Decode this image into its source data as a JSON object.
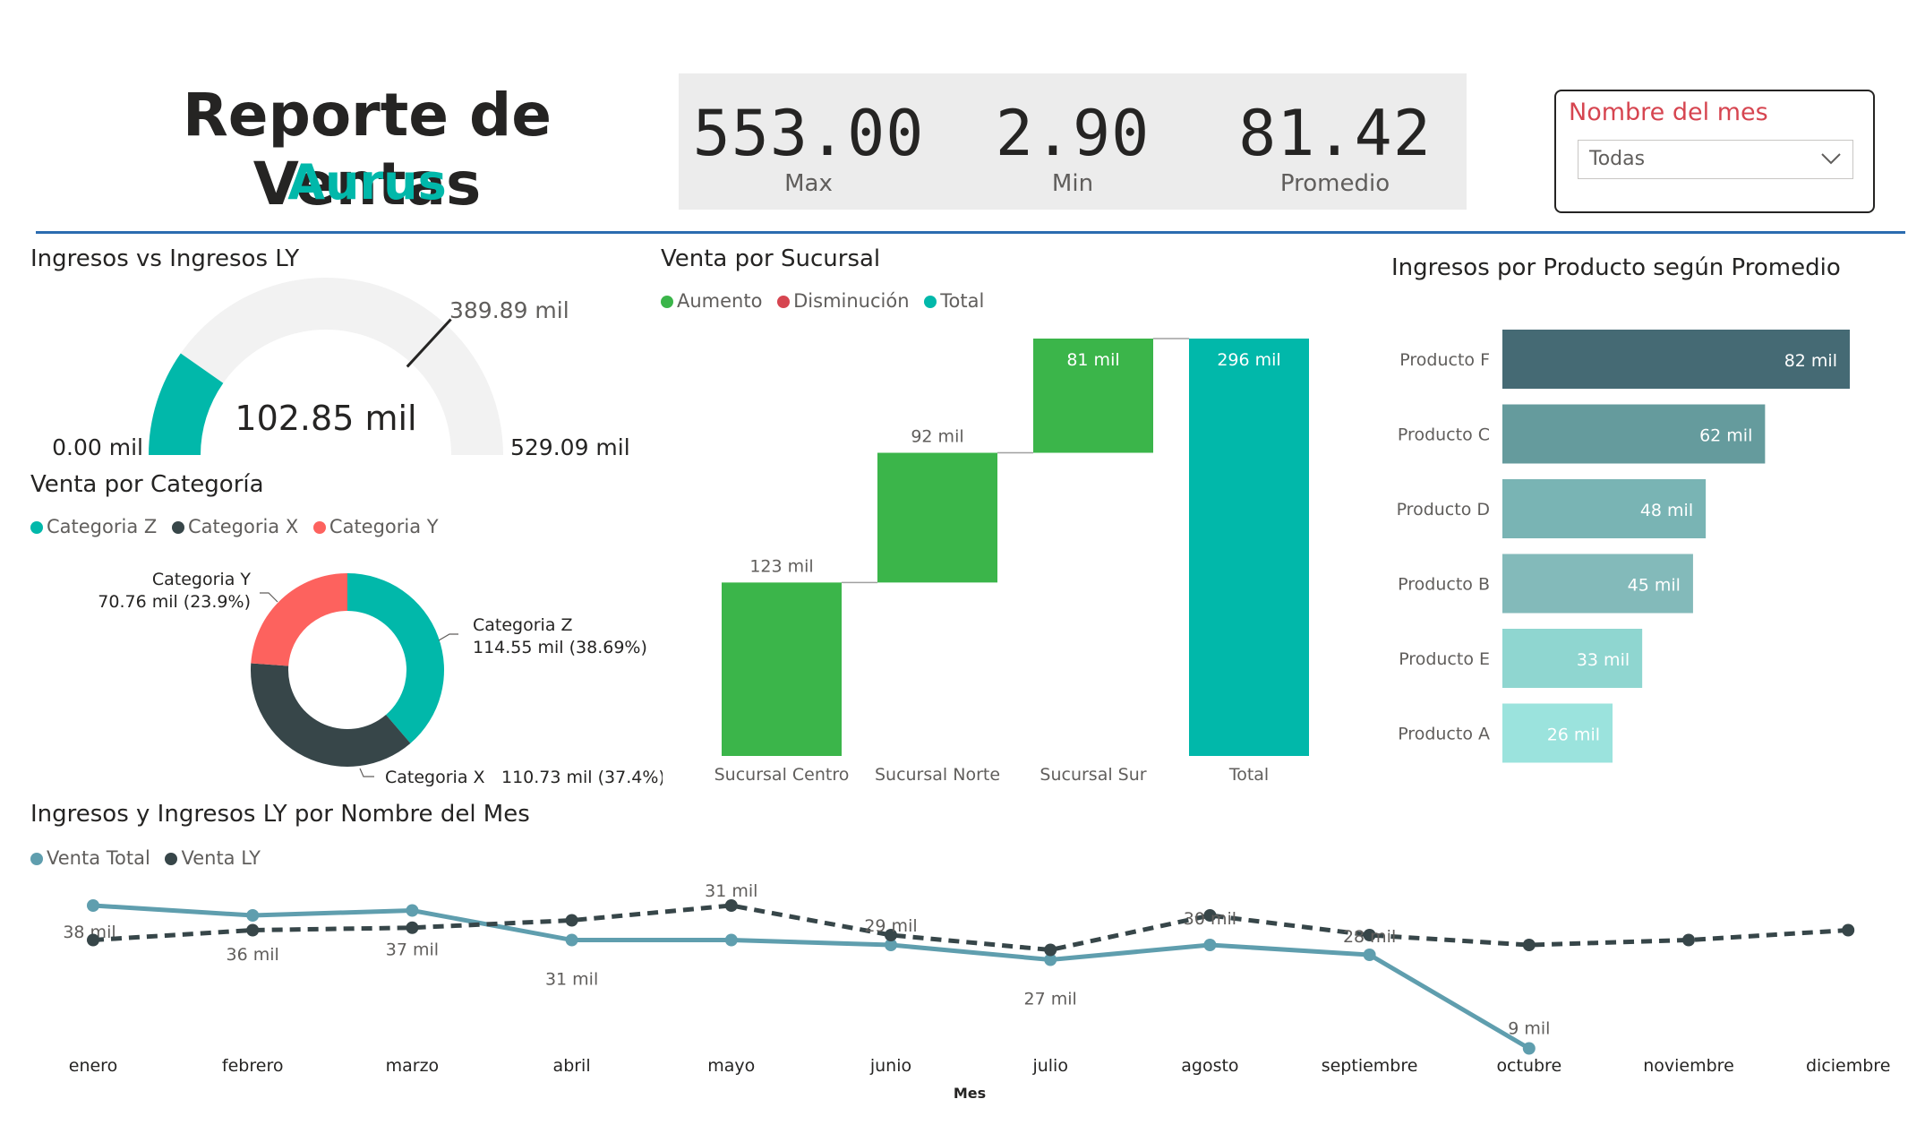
{
  "header": {
    "title": "Reporte de Ventas",
    "subtitle": "Aurus"
  },
  "kpis": [
    {
      "value": "553.00",
      "label": "Max"
    },
    {
      "value": "2.90",
      "label": "Min"
    },
    {
      "value": "81.42",
      "label": "Promedio"
    }
  ],
  "slicer": {
    "title": "Nombre del mes",
    "selected": "Todas"
  },
  "colors": {
    "teal": "#01b8aa",
    "dark": "#374649",
    "red": "#fd625e",
    "green": "#3bb54a",
    "decrease": "#d64550",
    "line_total": "#5f9eae",
    "line_ly": "#374649"
  },
  "chart_data": [
    {
      "id": "gauge",
      "type": "gauge",
      "title": "Ingresos vs Ingresos LY",
      "value": 102.85,
      "value_label": "102.85 mil",
      "min": 0,
      "min_label": "0.00 mil",
      "max": 529.09,
      "max_label": "529.09 mil",
      "target": 389.89,
      "target_label": "389.89 mil"
    },
    {
      "id": "donut",
      "type": "pie",
      "title": "Venta por Categoría",
      "legend": [
        "Categoria Z",
        "Categoria X",
        "Categoria Y"
      ],
      "slices": [
        {
          "name": "Categoria Z",
          "value": 114.55,
          "label": "114.55 mil (38.69%)",
          "color": "#01b8aa"
        },
        {
          "name": "Categoria X",
          "value": 110.73,
          "label": "110.73 mil (37.4%)",
          "color": "#374649"
        },
        {
          "name": "Categoria Y",
          "value": 70.76,
          "label": "70.76 mil (23.9%)",
          "color": "#fd625e"
        }
      ]
    },
    {
      "id": "waterfall",
      "type": "bar",
      "subtype": "waterfall",
      "title": "Venta por Sucursal",
      "legend": [
        {
          "name": "Aumento",
          "color": "#3bb54a"
        },
        {
          "name": "Disminución",
          "color": "#d64550"
        },
        {
          "name": "Total",
          "color": "#01b8aa"
        }
      ],
      "categories": [
        "Sucursal Centro",
        "Sucursal Norte",
        "Sucursal Sur",
        "Total"
      ],
      "values": [
        123,
        92,
        81,
        296
      ],
      "labels": [
        "123 mil",
        "92 mil",
        "81 mil",
        "296 mil"
      ],
      "ylim": [
        0,
        296
      ]
    },
    {
      "id": "hbar",
      "type": "bar",
      "orientation": "horizontal",
      "title": "Ingresos por Producto según Promedio",
      "categories": [
        "Producto F",
        "Producto C",
        "Producto D",
        "Producto B",
        "Producto E",
        "Producto A"
      ],
      "values": [
        82,
        62,
        48,
        45,
        33,
        26
      ],
      "labels": [
        "82 mil",
        "62 mil",
        "48 mil",
        "45 mil",
        "33 mil",
        "26 mil"
      ],
      "colors": [
        "#456a74",
        "#659b9d",
        "#79b4b4",
        "#83baba",
        "#8fd6d0",
        "#9be3dd"
      ],
      "xlim": [
        0,
        82
      ]
    },
    {
      "id": "line",
      "type": "line",
      "title": "Ingresos y Ingresos LY por Nombre del Mes",
      "xlabel": "Mes",
      "x": [
        "enero",
        "febrero",
        "marzo",
        "abril",
        "mayo",
        "junio",
        "julio",
        "agosto",
        "septiembre",
        "octubre",
        "noviembre",
        "diciembre"
      ],
      "series": [
        {
          "name": "Venta Total",
          "color": "#5f9eae",
          "dashed": false,
          "values": [
            38,
            36,
            37,
            31,
            31,
            30,
            27,
            30,
            28,
            9,
            null,
            null
          ],
          "labels": [
            "38 mil",
            "36 mil",
            "37 mil",
            "31 mil",
            "",
            "",
            "27 mil",
            "",
            "",
            "9 mil",
            "",
            ""
          ]
        },
        {
          "name": "Venta LY",
          "color": "#374649",
          "dashed": true,
          "values": [
            31,
            33,
            33.5,
            35,
            38,
            32,
            29,
            36,
            32,
            30,
            31,
            33
          ],
          "labels": [
            "",
            "",
            "",
            "",
            "31 mil",
            "29 mil",
            "",
            "30 mil",
            "28 mil",
            "",
            "",
            ""
          ]
        }
      ],
      "ylim": [
        0,
        40
      ]
    }
  ]
}
